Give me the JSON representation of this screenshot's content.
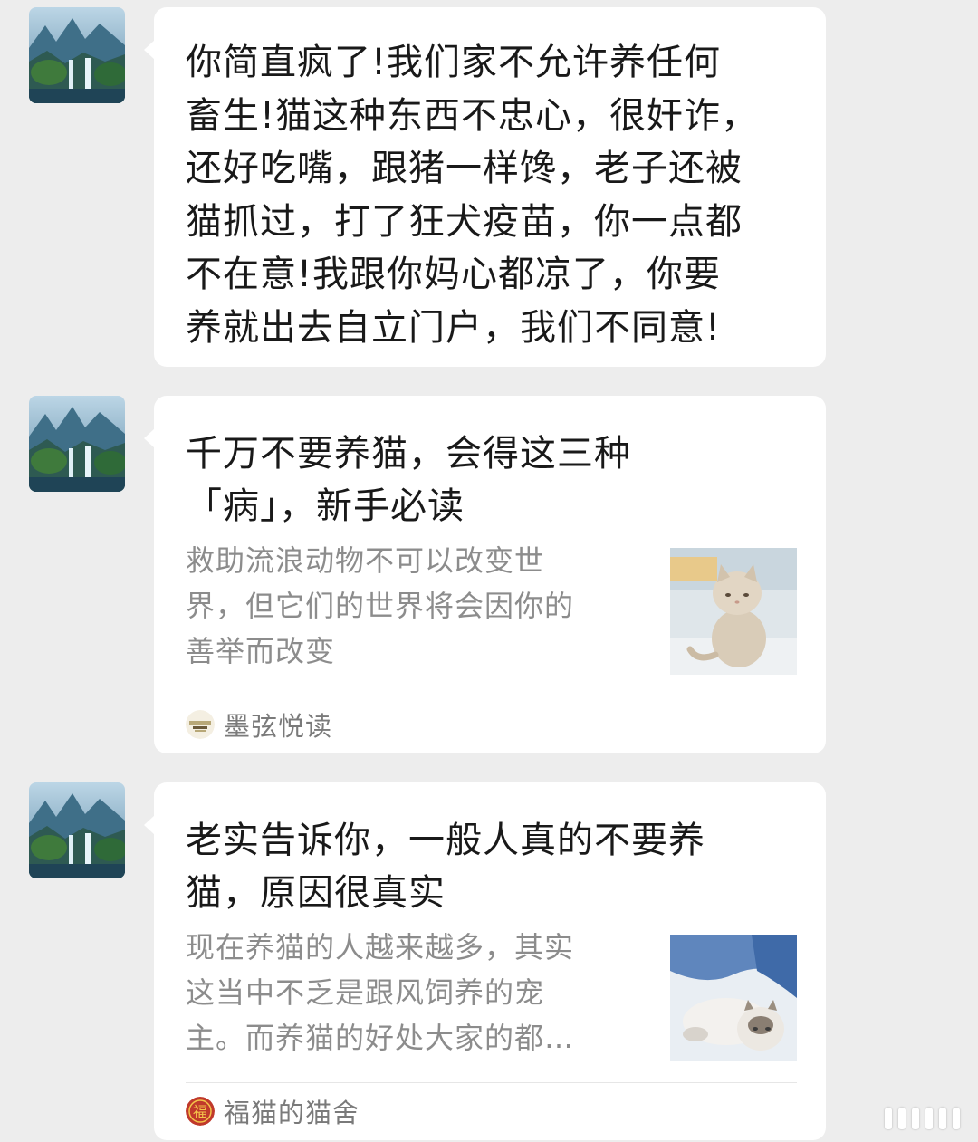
{
  "conversation": {
    "messages": [
      {
        "type": "text",
        "avatar": "landscape-avatar-icon",
        "text": "你简直疯了!我们家不允许养任何\n畜生!猫这种东西不忠心，很奸诈，\n还好吃嘴，跟猪一样馋，老子还被\n猫抓过，打了狂犬疫苗，你一点都\n不在意!我跟你妈心都凉了，你要\n养就出去自立门户，我们不同意!"
      },
      {
        "type": "link-card",
        "avatar": "landscape-avatar-icon",
        "title": "千万不要养猫，会得这三种\n「病」，新手必读",
        "description": "救助流浪动物不可以改变世\n界，但它们的世界将会因你的\n善举而改变",
        "thumbnail": "sitting-cat-photo",
        "source_icon": "moxian-logo-icon",
        "source_name": "墨弦悦读"
      },
      {
        "type": "link-card",
        "avatar": "landscape-avatar-icon",
        "title": "老实告诉你，一般人真的不要养\n猫，原因很真实",
        "description": "现在养猫的人越来越多，其实\n这当中不乏是跟风饲养的宠\n主。而养猫的好处大家的都…",
        "thumbnail": "lying-cat-photo",
        "source_icon": "fu-logo-icon",
        "source_name": "福猫的猫舍"
      }
    ]
  },
  "colors": {
    "background": "#ededed",
    "bubble": "#ffffff",
    "text_primary": "#191919",
    "text_secondary": "#8c8c8c",
    "source_text": "#7a7a7a",
    "fu_badge": "#c0392b"
  }
}
